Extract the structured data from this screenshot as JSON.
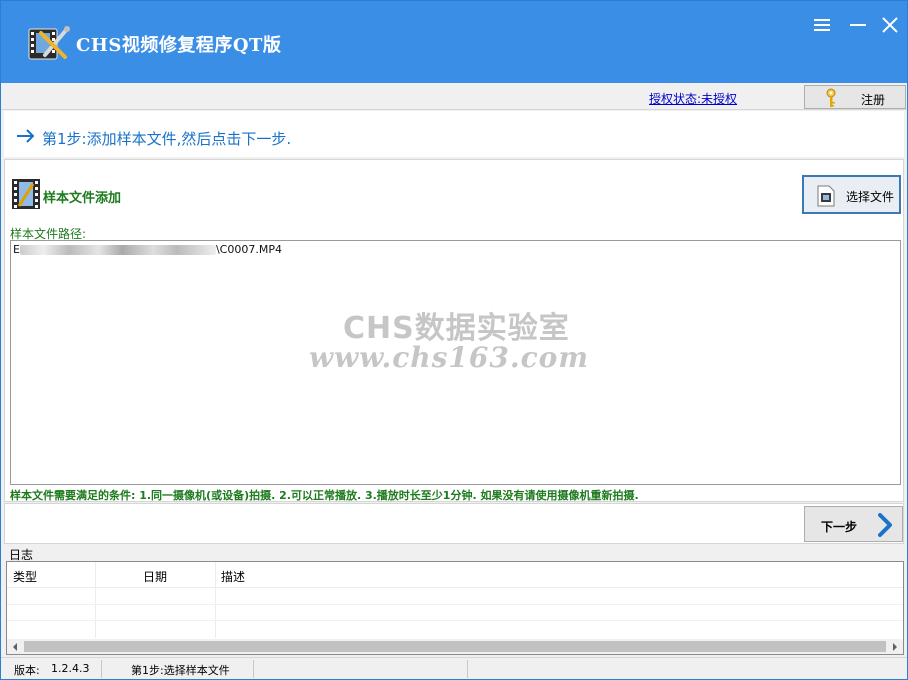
{
  "window": {
    "title": "CHS视频修复程序QT版",
    "logo_icon": "film-scissors-icon",
    "controls": [
      "menu-icon",
      "minimize-icon",
      "close-icon"
    ],
    "accent_color": "#3a8ee6"
  },
  "license": {
    "status_link": "授权状态:未授权",
    "register_label": "注册",
    "register_icon": "key-icon"
  },
  "step": {
    "text": "第1步:添加样本文件,然后点击下一步."
  },
  "sample": {
    "section_title": "样本文件添加",
    "choose_label": "选择文件",
    "path_label": "样本文件路径:",
    "path_prefix": "E",
    "path_suffix": "\\C0007.MP4",
    "watermark_line1": "CHS数据实验室",
    "watermark_line2": "www.chs163.com",
    "conditions": "样本文件需要满足的条件: 1.同一摄像机(或设备)拍摄. 2.可以正常播放. 3.播放时长至少1分钟. 如果没有请使用摄像机重新拍摄."
  },
  "nav": {
    "next_label": "下一步"
  },
  "log": {
    "label": "日志",
    "columns": [
      "类型",
      "日期",
      "描述"
    ]
  },
  "status": {
    "version_label": "版本:",
    "version_value": "1.2.4.3",
    "current_step": "第1步:选择样本文件"
  }
}
